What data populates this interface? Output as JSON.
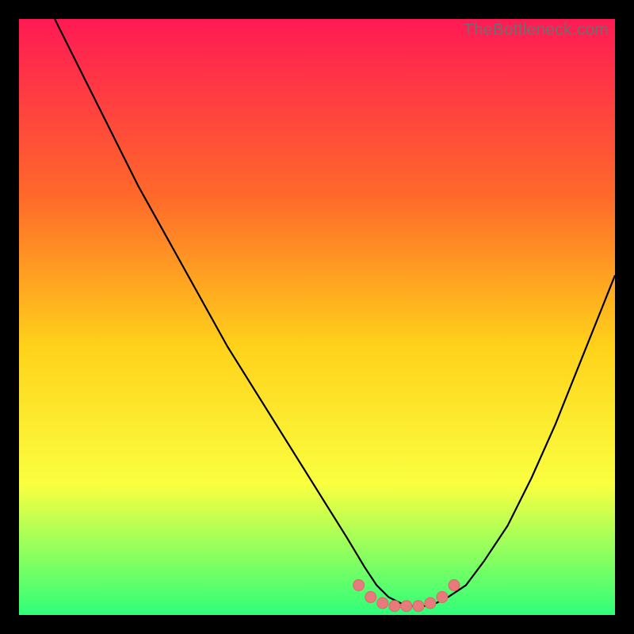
{
  "watermark": "TheBottleneck.com",
  "colors": {
    "background": "#000000",
    "gradient_top": "#ff1a54",
    "gradient_mid1": "#ff6a2a",
    "gradient_mid2": "#ffd21a",
    "gradient_mid3": "#faff40",
    "gradient_bottom": "#2eff7a",
    "curve_stroke": "#000000",
    "marker_fill": "#e77a7a",
    "marker_stroke": "#d86a6a"
  },
  "chart_data": {
    "type": "line",
    "title": "",
    "xlabel": "",
    "ylabel": "",
    "xlim": [
      0,
      100
    ],
    "ylim": [
      0,
      100
    ],
    "legend": false,
    "grid": false,
    "series": [
      {
        "name": "bottleneck-curve",
        "x": [
          6,
          10,
          15,
          20,
          25,
          30,
          35,
          40,
          45,
          50,
          55,
          58,
          60,
          62,
          64,
          66,
          68,
          70,
          72,
          75,
          78,
          82,
          86,
          90,
          94,
          98,
          100
        ],
        "y": [
          100,
          92,
          82,
          72,
          63,
          54,
          45,
          37,
          29,
          21,
          13,
          8,
          5,
          3,
          2,
          1.5,
          1.5,
          2,
          3,
          5,
          9,
          15,
          23,
          32,
          42,
          52,
          57
        ]
      }
    ],
    "markers": {
      "name": "optimal-region",
      "x": [
        57,
        59,
        61,
        63,
        65,
        67,
        69,
        71,
        73
      ],
      "y": [
        5,
        3,
        2,
        1.5,
        1.5,
        1.5,
        2,
        3,
        5
      ]
    }
  }
}
